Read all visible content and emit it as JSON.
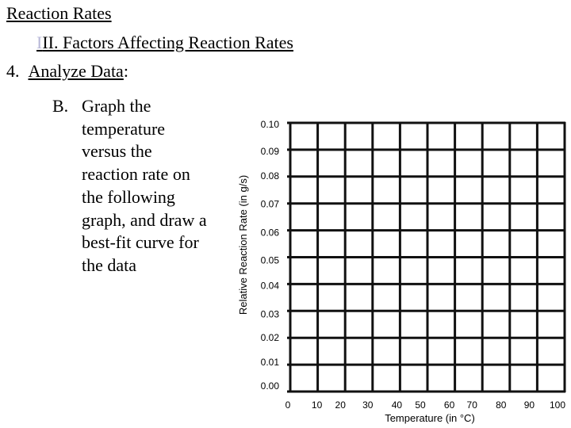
{
  "header": {
    "title": "Reaction Rates",
    "section_prefix": "I",
    "section": "II.  Factors Affecting Reaction Rates",
    "step_number": "4.",
    "step_label": "Analyze Data",
    "step_suffix": ":"
  },
  "instructions": {
    "label": "B.",
    "lines": [
      "Graph the",
      "temperature",
      "versus the",
      "reaction rate on",
      "the following",
      "graph, and draw a",
      "best-fit curve for",
      "the data"
    ]
  },
  "colors": {
    "grid": "#111111",
    "highlight_char": "#b8b8d8"
  },
  "chart_data": {
    "type": "line",
    "title": "",
    "xlabel": "Temperature (in °C)",
    "ylabel": "Relative Reaction Rate (in g/s)",
    "xlim": [
      0,
      100
    ],
    "ylim": [
      0.0,
      0.1
    ],
    "grid": true,
    "x_ticks": [
      "0",
      "10",
      "20",
      "30",
      "40",
      "50",
      "60",
      "70",
      "80",
      "90",
      "100"
    ],
    "y_ticks": [
      "0.10",
      "0.09",
      "0.08",
      "0.07",
      "0.06",
      "0.05",
      "0.04",
      "0.03",
      "0.02",
      "0.01",
      "0.00"
    ],
    "series": []
  }
}
